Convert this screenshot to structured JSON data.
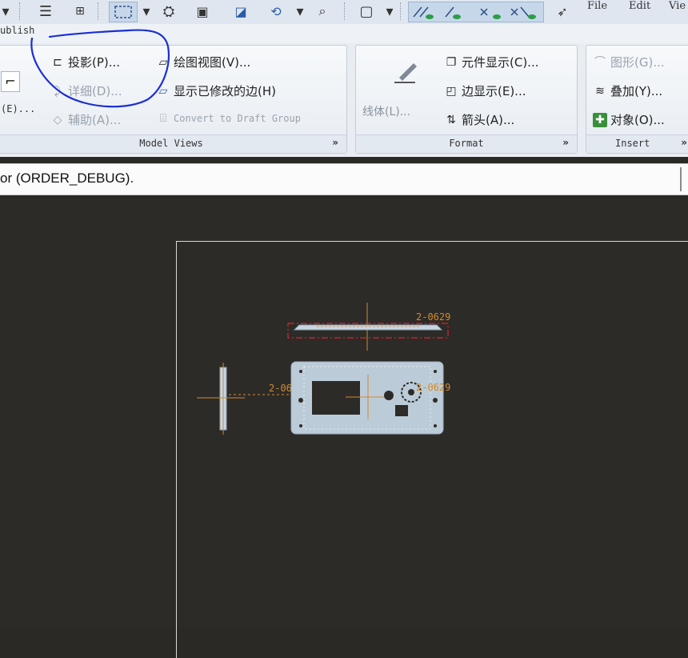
{
  "menu": {
    "file": "File",
    "edit": "Edit",
    "view": "Vie"
  },
  "publish_label": "ublish",
  "panels": {
    "model_views": {
      "title": "Model Views",
      "left_partial": "(E)...",
      "projection": "投影(P)...",
      "detailed": "详细(D)...",
      "auxiliary": "辅助(A)...",
      "drawing_view": "绘图视图(V)...",
      "show_modified_edges": "显示已修改的边(H)",
      "convert_to_draft_group": "Convert to Draft Group"
    },
    "format": {
      "title": "Format",
      "line_style": "线体(L)...",
      "component_display": "元件显示(C)...",
      "edge_display": "边显示(E)...",
      "arrow": "箭头(A)..."
    },
    "insert": {
      "title": "Insert",
      "graphics": "图形(G)...",
      "overlay": "叠加(Y)...",
      "object": "对象(O)..."
    }
  },
  "status_message": "or (ORDER_DEBUG).",
  "drawing": {
    "dim_top": "2-0629",
    "dim_left": "2-0629",
    "dim_right": "2-0629"
  },
  "colors": {
    "canvas": "#2d2b28",
    "annotation": "#1a2fd6",
    "dimension": "#d08b2c",
    "part": "#bccbd8",
    "selection": "#e0202a"
  },
  "icons": {
    "projection": "projection-icon",
    "detailed": "detail-view-icon",
    "auxiliary": "auxiliary-view-icon",
    "drawing_view": "drawing-view-icon",
    "modified_edges": "modified-edges-icon",
    "convert": "convert-icon",
    "line_style": "line-style-icon",
    "component_display": "component-display-icon",
    "edge_display": "edge-display-icon",
    "arrow": "arrow-icon",
    "graphics": "graphics-icon",
    "overlay": "overlay-icon",
    "object": "object-icon"
  }
}
